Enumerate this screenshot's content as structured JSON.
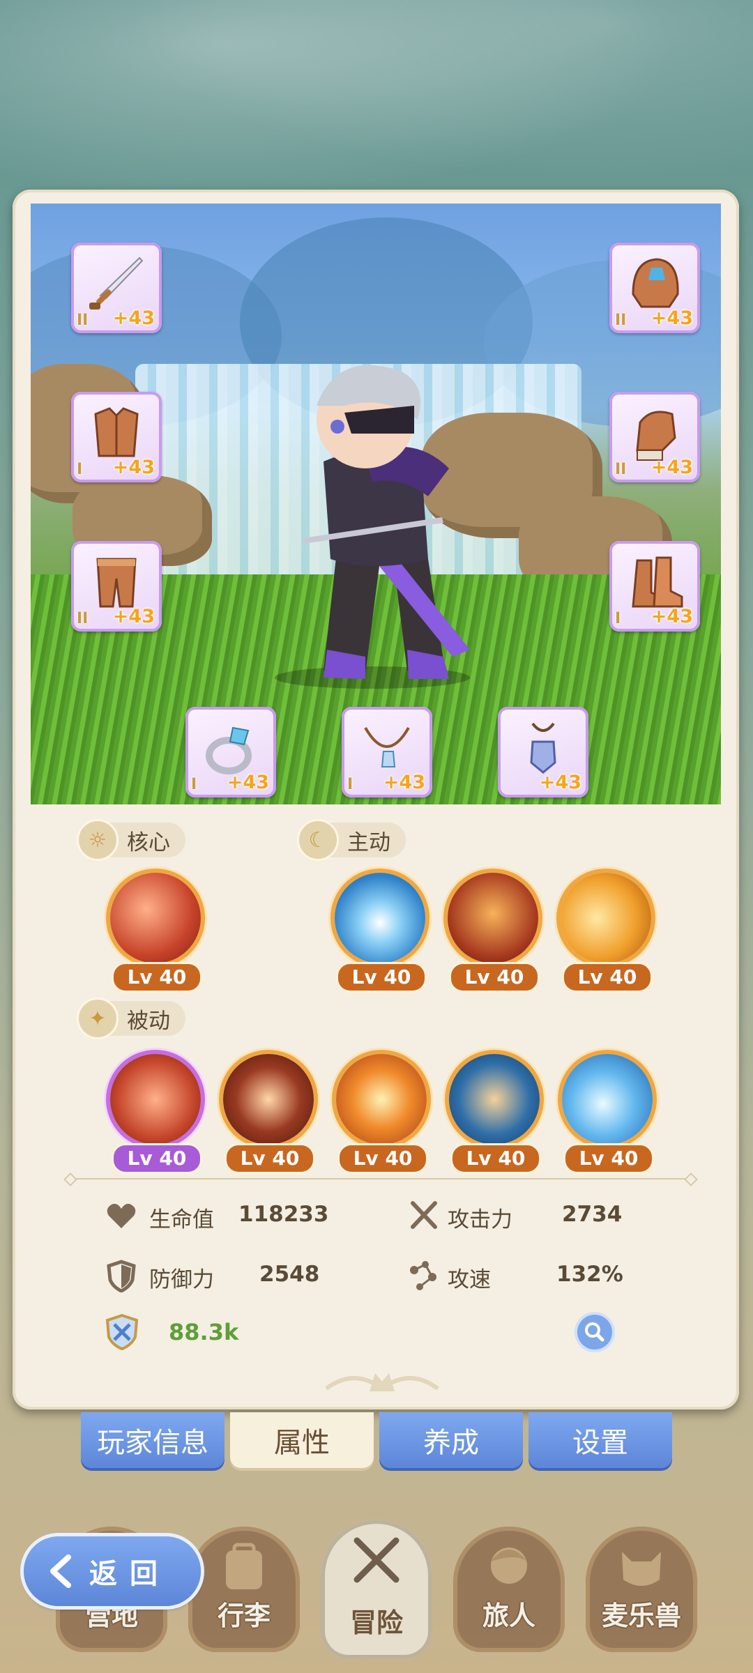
{
  "equipment": {
    "left": [
      {
        "name": "sword",
        "tier": "II",
        "plus": "+43"
      },
      {
        "name": "chest-armor",
        "tier": "I",
        "plus": "+43"
      },
      {
        "name": "leg-armor",
        "tier": "II",
        "plus": "+43"
      }
    ],
    "right": [
      {
        "name": "helmet",
        "tier": "II",
        "plus": "+43"
      },
      {
        "name": "gauntlet",
        "tier": "II",
        "plus": "+43"
      },
      {
        "name": "boots",
        "tier": "I",
        "plus": "+43"
      }
    ],
    "bottom": [
      {
        "name": "ring",
        "tier": "I",
        "plus": "+43"
      },
      {
        "name": "necklace",
        "tier": "I",
        "plus": "+43"
      },
      {
        "name": "amulet",
        "tier": "",
        "plus": "+43"
      }
    ]
  },
  "sections": {
    "core": "核心",
    "active": "主动",
    "passive": "被动"
  },
  "skills": {
    "core": [
      {
        "lv": "Lv 40"
      }
    ],
    "active": [
      {
        "lv": "Lv 40"
      },
      {
        "lv": "Lv 40"
      },
      {
        "lv": "Lv 40"
      }
    ],
    "passive": [
      {
        "lv": "Lv 40"
      },
      {
        "lv": "Lv 40"
      },
      {
        "lv": "Lv 40"
      },
      {
        "lv": "Lv 40"
      },
      {
        "lv": "Lv 40"
      }
    ]
  },
  "stats": {
    "hp_label": "生命值",
    "hp_value": "118233",
    "atk_label": "攻击力",
    "atk_value": "2734",
    "def_label": "防御力",
    "def_value": "2548",
    "spd_label": "攻速",
    "spd_value": "132%",
    "power": "88.3k"
  },
  "tabs": [
    {
      "label": "玩家信息"
    },
    {
      "label": "属性"
    },
    {
      "label": "养成"
    },
    {
      "label": "设置"
    }
  ],
  "active_tab": "属性",
  "bottom_nav": [
    {
      "label": "营地"
    },
    {
      "label": "行李"
    },
    {
      "label": "冒险"
    },
    {
      "label": "旅人"
    },
    {
      "label": "麦乐兽"
    }
  ],
  "back_label": "返回",
  "colors": {
    "accent_blue": "#6d96e4",
    "level_orange": "#c8671f",
    "level_purple": "#a85bd6",
    "power_green": "#5f9e3a"
  }
}
